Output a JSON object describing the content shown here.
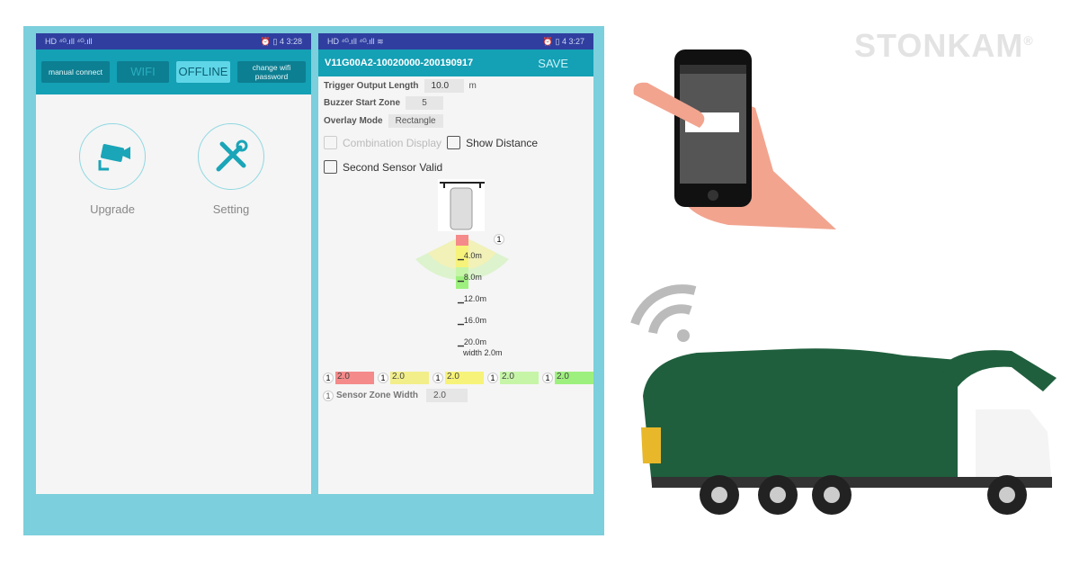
{
  "brand": {
    "name": "STONKAM",
    "reg": "®"
  },
  "phone1": {
    "status_left": "HD ⁴ᴳ.ıll ⁴ᴳ.ıll",
    "status_right": "⏰ ▯ 4 3:28",
    "buttons": [
      "manual connect",
      "WIFI",
      "OFFLINE",
      "change wifi password"
    ],
    "tiles": [
      {
        "label": "Upgrade",
        "icon": "camera-icon"
      },
      {
        "label": "Setting",
        "icon": "tools-icon"
      }
    ]
  },
  "phone2": {
    "status_left": "HD ⁴ᴳ.ıll ⁴ᴳ.ıll ≋",
    "status_right": "⏰ ▯ 4 3:27",
    "title": "V11G00A2-10020000-200190917",
    "save": "SAVE",
    "trigger_label": "Trigger Output Length",
    "trigger_value": "10.0",
    "trigger_unit": "m",
    "buzzer_label": "Buzzer Start Zone",
    "buzzer_value": "5",
    "overlay_label": "Overlay Mode",
    "overlay_value": "Rectangle",
    "combination": "Combination Display",
    "show_distance": "Show Distance",
    "second_sensor": "Second Sensor Valid",
    "sensor_num": "1",
    "ticks": [
      "4.0m",
      "8.0m",
      "12.0m",
      "16.0m",
      "20.0m"
    ],
    "width_label": "width 2.0m",
    "zones": [
      {
        "n": "1",
        "v": "2.0",
        "color": "#f58a8a"
      },
      {
        "n": "1",
        "v": "2.0",
        "color": "#f2ee8a"
      },
      {
        "n": "1",
        "v": "2.0",
        "color": "#f7f37a"
      },
      {
        "n": "1",
        "v": "2.0",
        "color": "#c6f5a8"
      },
      {
        "n": "1",
        "v": "2.0",
        "color": "#9ef07e"
      }
    ],
    "zone_width_n": "1",
    "zone_width_label": "Sensor Zone Width",
    "zone_width_value": "2.0"
  }
}
